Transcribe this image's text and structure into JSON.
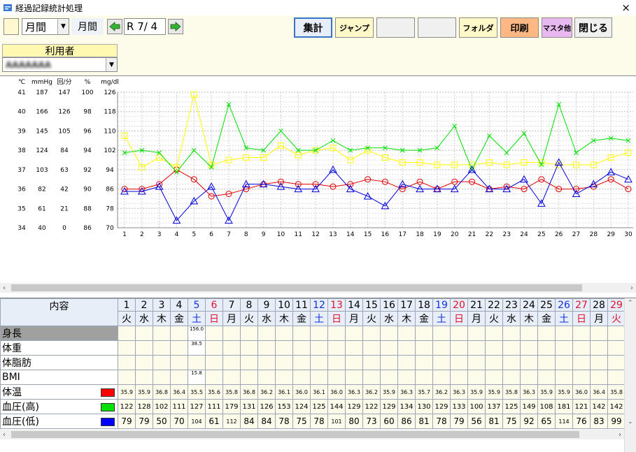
{
  "window": {
    "title": "経過記録統計処理",
    "close": "×"
  },
  "toolbar": {
    "period_select": "月間",
    "period_label": "月間",
    "date": "R 7/ 4",
    "buttons": {
      "aggregate": "集計",
      "jump": "ジャンプ",
      "folder": "フォルダ",
      "print": "印刷",
      "master": "マスタ他",
      "close": "閉じる"
    },
    "user_label": "利用者",
    "user_value": "AAAAAAA"
  },
  "chart": {
    "axis_headers": [
      "℃",
      "mmHg",
      "回/分",
      "%",
      "mg/dl"
    ],
    "axis_rows": [
      [
        "41",
        "187",
        "147",
        "100",
        "126"
      ],
      [
        "40",
        "166",
        "126",
        "98",
        "118"
      ],
      [
        "39",
        "145",
        "105",
        "96",
        "110"
      ],
      [
        "38",
        "124",
        "84",
        "94",
        "102"
      ],
      [
        "37",
        "103",
        "63",
        "92",
        "94"
      ],
      [
        "36",
        "82",
        "42",
        "90",
        "86"
      ],
      [
        "35",
        "61",
        "21",
        "88",
        "78"
      ],
      [
        "34",
        "40",
        "0",
        "86",
        "70"
      ]
    ],
    "x_labels": [
      "1",
      "2",
      "3",
      "4",
      "5",
      "6",
      "7",
      "8",
      "9",
      "10",
      "11",
      "12",
      "13",
      "14",
      "15",
      "16",
      "17",
      "18",
      "19",
      "20",
      "21",
      "22",
      "23",
      "24",
      "25",
      "26",
      "27",
      "28",
      "29",
      "30"
    ]
  },
  "chart_data": {
    "type": "line",
    "x": [
      1,
      2,
      3,
      4,
      5,
      6,
      7,
      8,
      9,
      10,
      11,
      12,
      13,
      14,
      15,
      16,
      17,
      18,
      19,
      20,
      21,
      22,
      23,
      24,
      25,
      26,
      27,
      28,
      29,
      30
    ],
    "ylim": [
      70,
      126
    ],
    "series": [
      {
        "color": "#e00000",
        "marker": "circle",
        "values": [
          86,
          86,
          88,
          94,
          90,
          83,
          84,
          86,
          88,
          89,
          88,
          88,
          87,
          88,
          90,
          89,
          86,
          89,
          86,
          89,
          89,
          86,
          87,
          86,
          90,
          86,
          86,
          87,
          90,
          86
        ]
      },
      {
        "color": "#ffff00",
        "marker": "square",
        "values": [
          108,
          95,
          99,
          95,
          125,
          96,
          98,
          99,
          99,
          104,
          100,
          102,
          103,
          98,
          102,
          99,
          97,
          97,
          96,
          96,
          96,
          97,
          96,
          97,
          97,
          96,
          96,
          96,
          99,
          101
        ]
      },
      {
        "color": "#00e000",
        "marker": "x",
        "values": [
          101,
          102,
          101,
          93,
          102,
          95,
          121,
          103,
          102,
          110,
          102,
          102,
          106,
          102,
          103,
          103,
          102,
          102,
          103,
          112,
          94,
          108,
          101,
          109,
          96,
          121,
          101,
          106,
          107,
          106
        ]
      },
      {
        "color": "#0000e0",
        "marker": "triangle",
        "values": [
          85,
          85,
          87,
          73,
          81,
          87,
          73,
          88,
          88,
          87,
          86,
          86,
          94,
          86,
          83,
          79,
          88,
          86,
          86,
          86,
          94,
          86,
          86,
          90,
          80,
          97,
          84,
          88,
          93,
          90
        ]
      }
    ]
  },
  "table": {
    "content_header": "内容",
    "days": [
      "1",
      "2",
      "3",
      "4",
      "5",
      "6",
      "7",
      "8",
      "9",
      "10",
      "11",
      "12",
      "13",
      "14",
      "15",
      "16",
      "17",
      "18",
      "19",
      "20",
      "21",
      "22",
      "23",
      "24",
      "25",
      "26",
      "27",
      "28",
      "29"
    ],
    "weekdays": [
      "火",
      "水",
      "木",
      "金",
      "土",
      "日",
      "月",
      "火",
      "水",
      "木",
      "金",
      "土",
      "日",
      "月",
      "火",
      "水",
      "木",
      "金",
      "土",
      "日",
      "月",
      "火",
      "水",
      "木",
      "金",
      "土",
      "日",
      "月",
      "火"
    ],
    "day_types": [
      "n",
      "n",
      "n",
      "n",
      "sat",
      "sun",
      "n",
      "n",
      "n",
      "n",
      "n",
      "sat",
      "sun",
      "n",
      "n",
      "n",
      "n",
      "n",
      "sat",
      "sun",
      "n",
      "n",
      "n",
      "n",
      "n",
      "sat",
      "sun",
      "n",
      "sun"
    ],
    "rows": [
      {
        "label": "身長",
        "swatch": "",
        "values": [
          "",
          "",
          "",
          "",
          "156.0",
          "",
          "",
          "",
          "",
          "",
          "",
          "",
          "",
          "",
          "",
          "",
          "",
          "",
          "",
          "",
          "",
          "",
          "",
          "",
          "",
          "",
          "",
          "",
          ""
        ]
      },
      {
        "label": "体重",
        "swatch": "",
        "values": [
          "",
          "",
          "",
          "",
          "38.5",
          "",
          "",
          "",
          "",
          "",
          "",
          "",
          "",
          "",
          "",
          "",
          "",
          "",
          "",
          "",
          "",
          "",
          "",
          "",
          "",
          "",
          "",
          "",
          ""
        ]
      },
      {
        "label": "体脂肪",
        "swatch": "",
        "values": [
          "",
          "",
          "",
          "",
          "",
          "",
          "",
          "",
          "",
          "",
          "",
          "",
          "",
          "",
          "",
          "",
          "",
          "",
          "",
          "",
          "",
          "",
          "",
          "",
          "",
          "",
          "",
          "",
          ""
        ]
      },
      {
        "label": "BMI",
        "swatch": "",
        "values": [
          "",
          "",
          "",
          "",
          "15.8",
          "",
          "",
          "",
          "",
          "",
          "",
          "",
          "",
          "",
          "",
          "",
          "",
          "",
          "",
          "",
          "",
          "",
          "",
          "",
          "",
          "",
          "",
          "",
          ""
        ]
      },
      {
        "label": "体温",
        "swatch": "#ff0000",
        "values": [
          "35.9",
          "35.9",
          "36.8",
          "36.4",
          "35.5",
          "35.6",
          "35.8",
          "36.8",
          "36.2",
          "36.1",
          "36.0",
          "36.1",
          "36.0",
          "36.3",
          "36.2",
          "35.9",
          "36.3",
          "35.7",
          "36.2",
          "36.3",
          "35.9",
          "35.9",
          "35.8",
          "36.3",
          "35.9",
          "35.9",
          "36.0",
          "36.4",
          "35.8"
        ]
      },
      {
        "label": "血圧(高)",
        "swatch": "#00e000",
        "values": [
          "122",
          "128",
          "102",
          "111",
          "127",
          "111",
          "179",
          "131",
          "126",
          "153",
          "124",
          "125",
          "144",
          "129",
          "122",
          "129",
          "134",
          "130",
          "129",
          "133",
          "100",
          "137",
          "125",
          "149",
          "108",
          "181",
          "121",
          "142",
          "142"
        ]
      },
      {
        "label": "血圧(低)",
        "swatch": "#0000ff",
        "values": [
          "79",
          "79",
          "50",
          "70",
          "104",
          "61",
          "112",
          "84",
          "84",
          "78",
          "75",
          "78",
          "101",
          "80",
          "73",
          "60",
          "86",
          "81",
          "78",
          "79",
          "56",
          "81",
          "75",
          "92",
          "65",
          "114",
          "76",
          "83",
          "99"
        ]
      }
    ]
  }
}
